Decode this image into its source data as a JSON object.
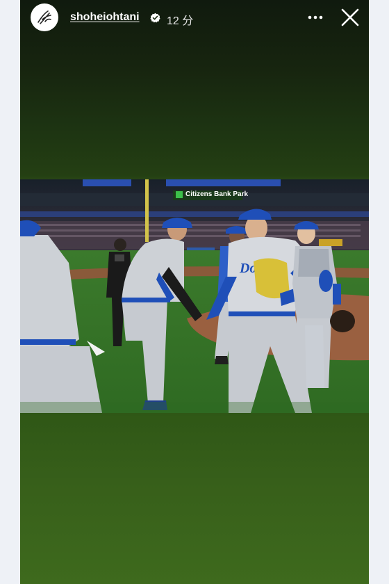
{
  "story": {
    "username": "shoheiohtani",
    "verified": true,
    "time_ago": "12 分",
    "more_icon": "more-horizontal-icon",
    "close_icon": "close-icon"
  },
  "photo": {
    "signage": "Citizens Bank Park"
  },
  "colors": {
    "background_outer": "#eef1f6",
    "story_top": "#101a0e",
    "story_bottom": "#3e6a1d",
    "dodger_blue": "#1f4fb8",
    "uniform_gray": "#c9cdd3"
  }
}
